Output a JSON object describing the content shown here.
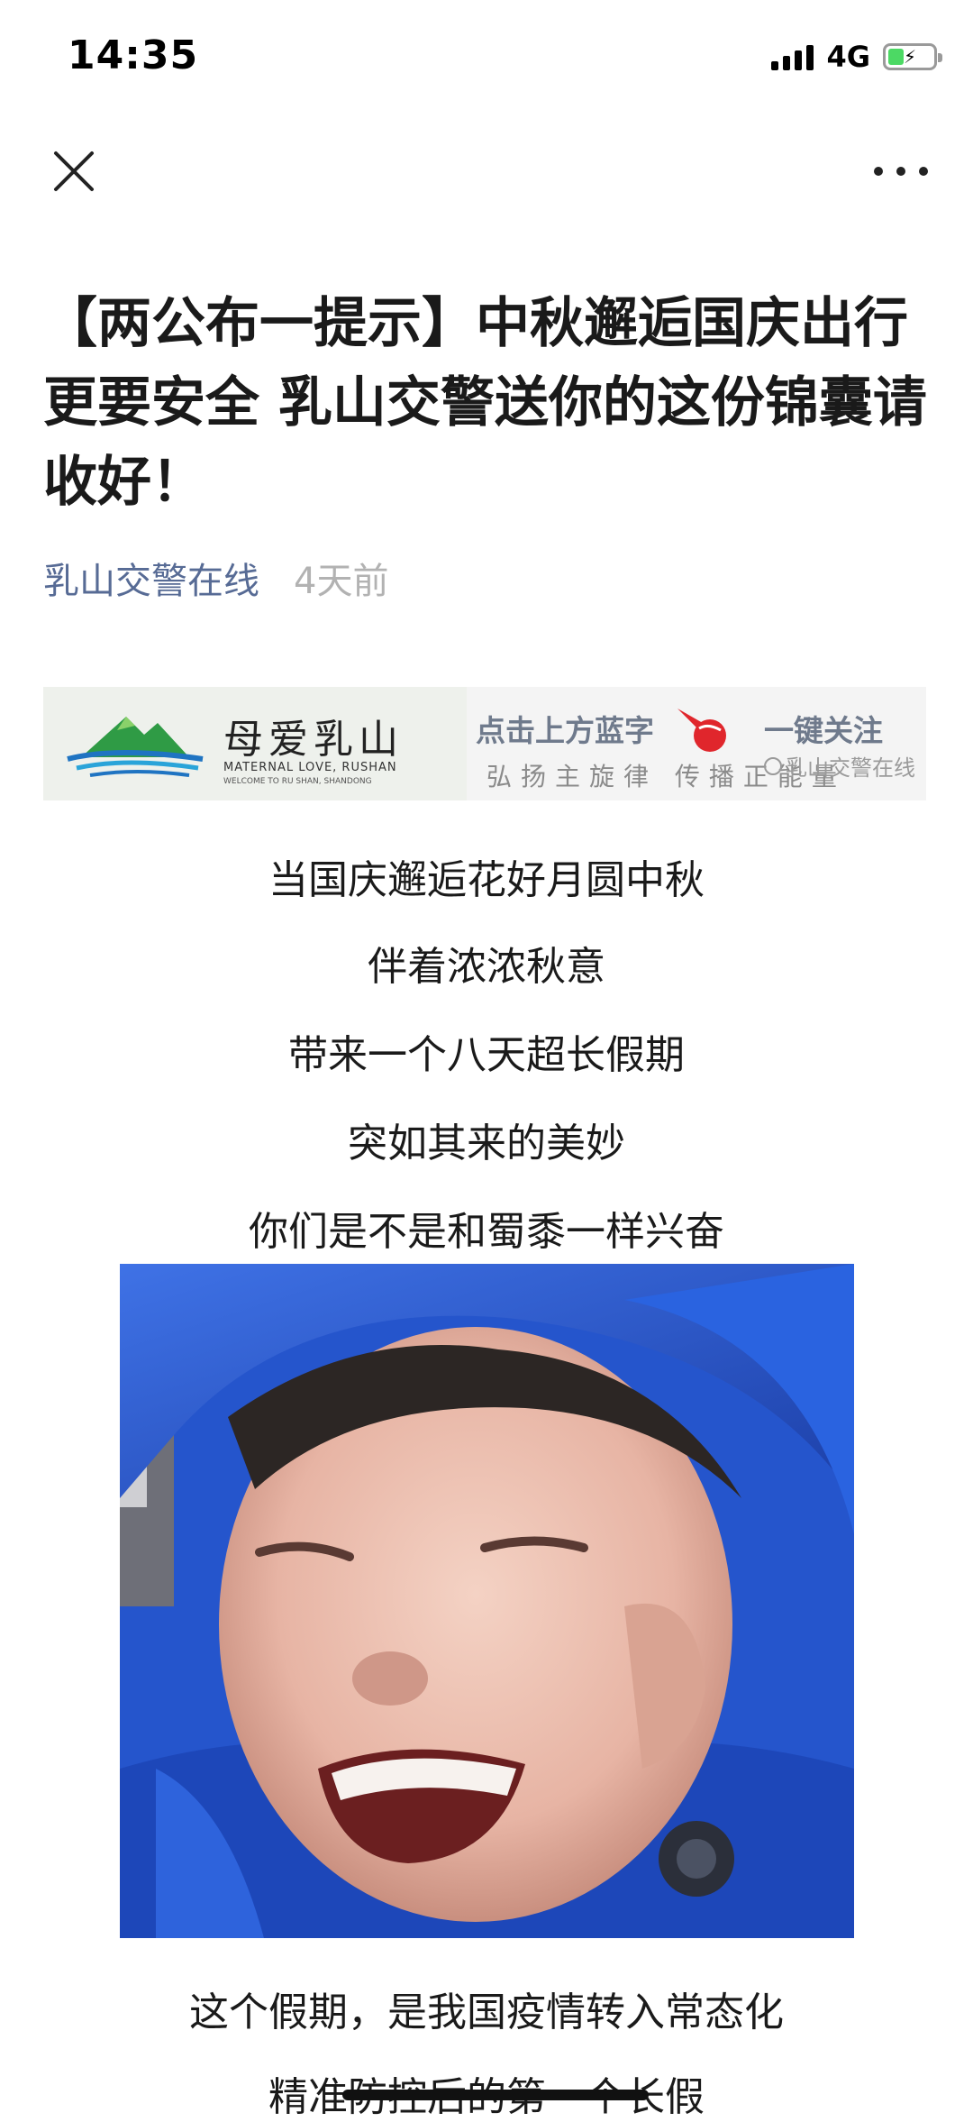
{
  "status_bar": {
    "time": "14:35",
    "network": "4G",
    "battery_level": 0.36
  },
  "nav": {
    "close_icon": "close-icon",
    "more_icon": "more-icon"
  },
  "article": {
    "title": "【两公布一提示】中秋邂逅国庆出行更要安全 乳山交警送你的这份锦囊请收好！",
    "author": "乳山交警在线",
    "time": "4天前"
  },
  "banner": {
    "brand_cn": "母爱乳山",
    "brand_en": "MATERNAL LOVE, RUSHAN",
    "brand_en_sub": "WELCOME TO RU SHAN, SHANDONG",
    "click_text": "点击上方蓝字",
    "slogan": "弘扬主旋律 传播正能量",
    "follow_text": "一键关注",
    "watermark": "乳山交警在线"
  },
  "body_lines": [
    "当国庆邂逅花好月圆中秋",
    "伴着浓浓秋意",
    "带来一个八天超长假期",
    "突如其来的美妙",
    "你们是不是和蜀黍一样兴奋"
  ],
  "after_photo_lines": [
    "这个假期，是我国疫情转入常态化",
    "精准防控后的第一个长假"
  ],
  "colors": {
    "author": "#576b95",
    "time": "#b2b2b2",
    "photo_bg": "#2a5bd6"
  }
}
